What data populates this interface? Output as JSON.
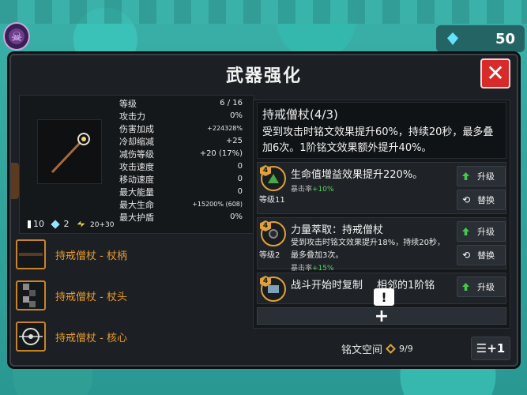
{
  "hud": {
    "gem_count": "50"
  },
  "dialog": {
    "title": "武器强化",
    "close_label": "✕"
  },
  "stats": [
    {
      "label": "等级",
      "value": "6 / 16"
    },
    {
      "label": "攻击力",
      "value": "0%"
    },
    {
      "label": "伤害加成",
      "value": "+224328%"
    },
    {
      "label": "冷却缩减",
      "value": "+25"
    },
    {
      "label": "减伤等级",
      "value": "+20 (17%)"
    },
    {
      "label": "攻击速度",
      "value": "0"
    },
    {
      "label": "移动速度",
      "value": "0"
    },
    {
      "label": "最大能量",
      "value": "0"
    },
    {
      "label": "最大生命",
      "value": "+15200% (608)"
    },
    {
      "label": "最大护盾",
      "value": "0%"
    }
  ],
  "mini_stats": {
    "a": "10",
    "b": "2",
    "c": "20+30"
  },
  "parts": [
    {
      "label": "持戒僧杖 - 杖柄"
    },
    {
      "label": "持戒僧杖 - 杖头"
    },
    {
      "label": "持戒僧杖 - 核心"
    }
  ],
  "description": {
    "title": "持戒僧杖(4/3)",
    "text": "受到攻击时铭文效果提升60%，持续20秒，最多叠加6次。1阶铭文效果额外提升40%。"
  },
  "runes": [
    {
      "tier": "4",
      "level_label": "等级11",
      "title": "生命值增益效果提升220%。",
      "desc": "",
      "crit_label": "暴击率",
      "crit_value": "+10%",
      "upgrade_label": "升级",
      "swap_label": "替换"
    },
    {
      "tier": "4",
      "level_label": "等级2",
      "title": "力量萃取：持戒僧杖",
      "desc": "受到攻击时铭文效果提升18%，持续20秒，最多叠加3次。",
      "crit_label": "暴击率",
      "crit_value": "+15%",
      "upgrade_label": "升级",
      "swap_label": "替换"
    },
    {
      "tier": "4",
      "title": "战斗开始时复制",
      "title_tail": "相邻的1阶铭",
      "upgrade_label": "升级"
    }
  ],
  "add_button": "+",
  "warning_mark": "!",
  "rune_space": {
    "label": "铭文空间",
    "value": "9/9"
  },
  "sort_button": "☰+1"
}
